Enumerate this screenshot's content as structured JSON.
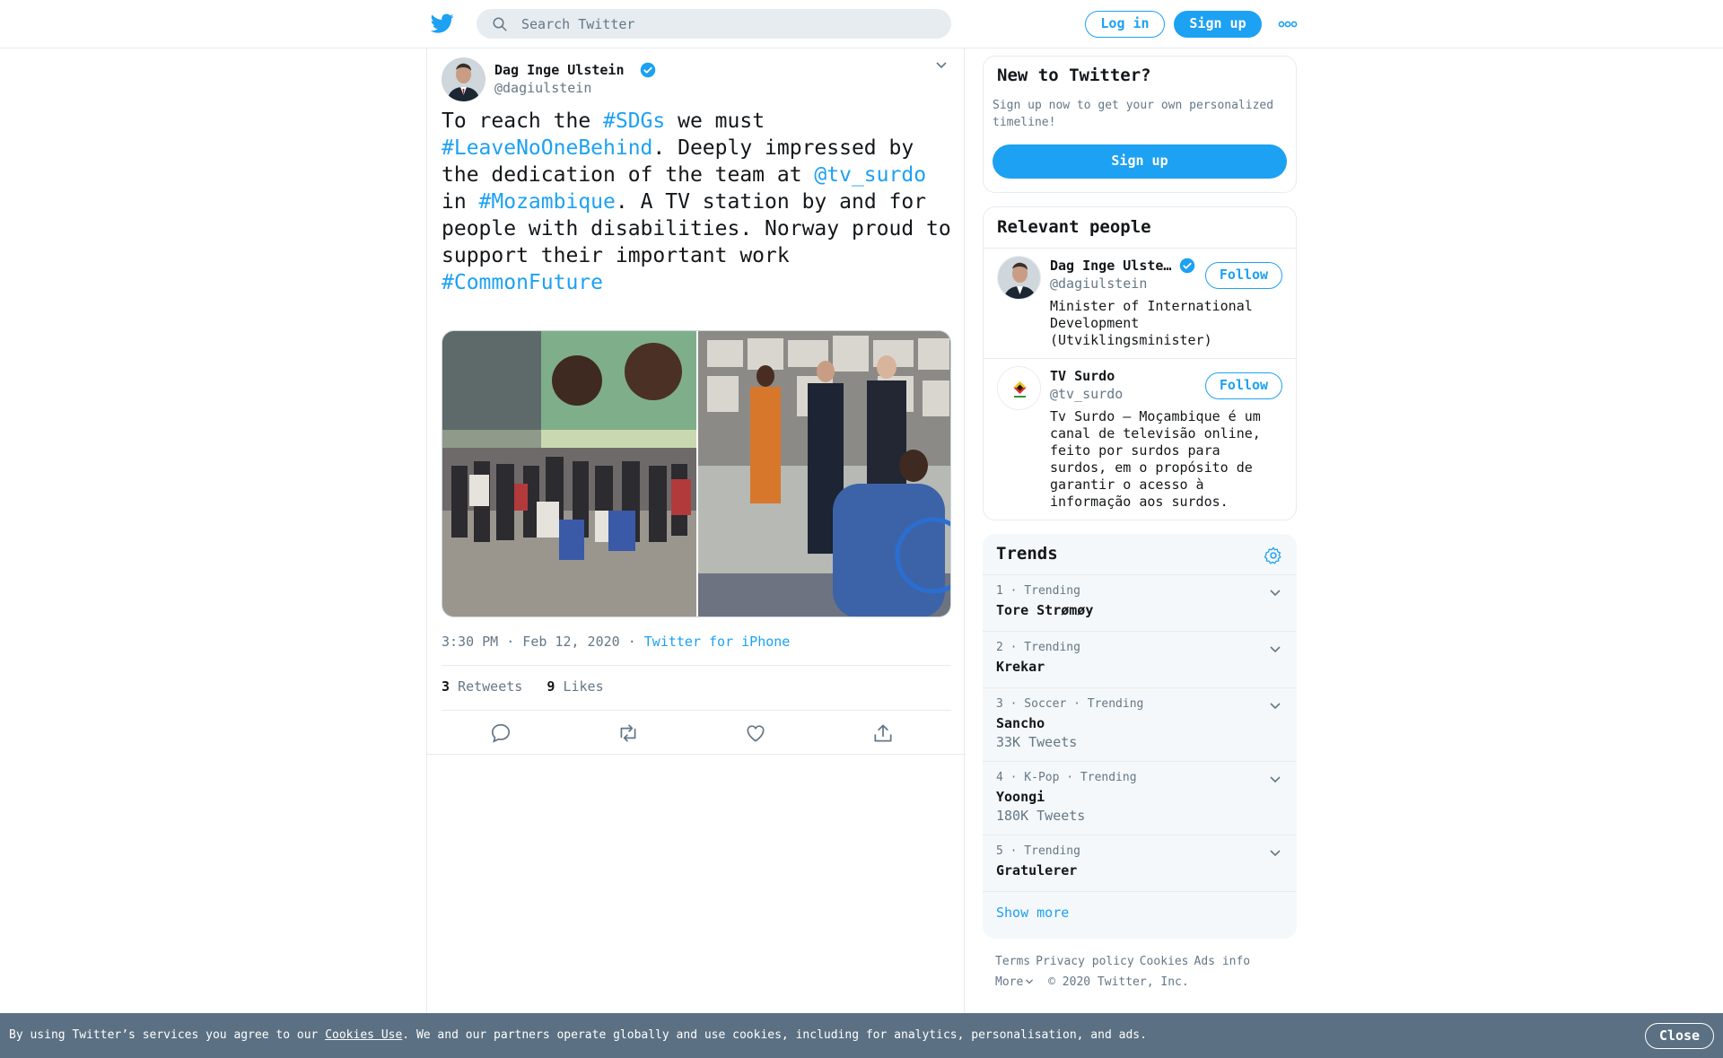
{
  "header": {
    "search_placeholder": "Search Twitter",
    "login_label": "Log in",
    "signup_label": "Sign up"
  },
  "tweet": {
    "author_name": "Dag Inge Ulstein",
    "handle": "@dagiulstein",
    "text_parts": {
      "p1": "To reach the ",
      "p2": "#SDGs",
      "p3": " we must\n",
      "p4": "#LeaveNoOneBehind",
      "p5": ". Deeply impressed by\nthe dedication of the team at ",
      "p6": "@tv_surdo",
      "p7": "\nin ",
      "p8": "#Mozambique",
      "p9": ". A TV station by and for\npeople with disabilities. Norway proud to\nsupport their important work\n",
      "p10": "#CommonFuture"
    },
    "time": "3:30 PM · Feb 12, 2020",
    "meta_sep": " · ",
    "source": "Twitter for iPhone",
    "retweets_count": "3",
    "retweets_label": "Retweets",
    "likes_count": "9",
    "likes_label": "Likes"
  },
  "new_to_twitter": {
    "title": "New to Twitter?",
    "desc": "Sign up now to get your own personalized timeline!",
    "button": "Sign up"
  },
  "relevant_people": {
    "title": "Relevant people",
    "people": [
      {
        "name": "Dag Inge Ulste…",
        "handle": "@dagiulstein",
        "bio": "Minister of International Development (Utviklingsminister)",
        "follow": "Follow"
      },
      {
        "name": "TV Surdo",
        "handle": "@tv_surdo",
        "bio": "Tv Surdo – Moçambique é um canal de televisão online, feito por surdos para surdos, em o propósito de garantir o acesso à informação aos surdos.",
        "follow": "Follow"
      }
    ]
  },
  "trends": {
    "title": "Trends",
    "items": [
      {
        "meta": "1 · Trending",
        "name": "Tore Strømøy",
        "count": ""
      },
      {
        "meta": "2 · Trending",
        "name": "Krekar",
        "count": ""
      },
      {
        "meta": "3 · Soccer · Trending",
        "name": "Sancho",
        "count": "33K Tweets"
      },
      {
        "meta": "4 · K-Pop · Trending",
        "name": "Yoongi",
        "count": "180K Tweets"
      },
      {
        "meta": "5 · Trending",
        "name": "Gratulerer",
        "count": ""
      }
    ],
    "show_more": "Show more"
  },
  "footer": {
    "terms": "Terms",
    "privacy": "Privacy policy",
    "cookies": "Cookies",
    "ads": "Ads info",
    "more": "More",
    "copyright": "© 2020 Twitter, Inc."
  },
  "cookie_banner": {
    "text_before": "By using Twitter’s services you agree to our ",
    "link": "Cookies Use",
    "text_after": ". We and our partners operate globally and use cookies, including for analytics, personalisation, and ads.",
    "close": "Close"
  },
  "colors": {
    "brand_blue": "#1da1f2",
    "banner": "#5b7083"
  }
}
